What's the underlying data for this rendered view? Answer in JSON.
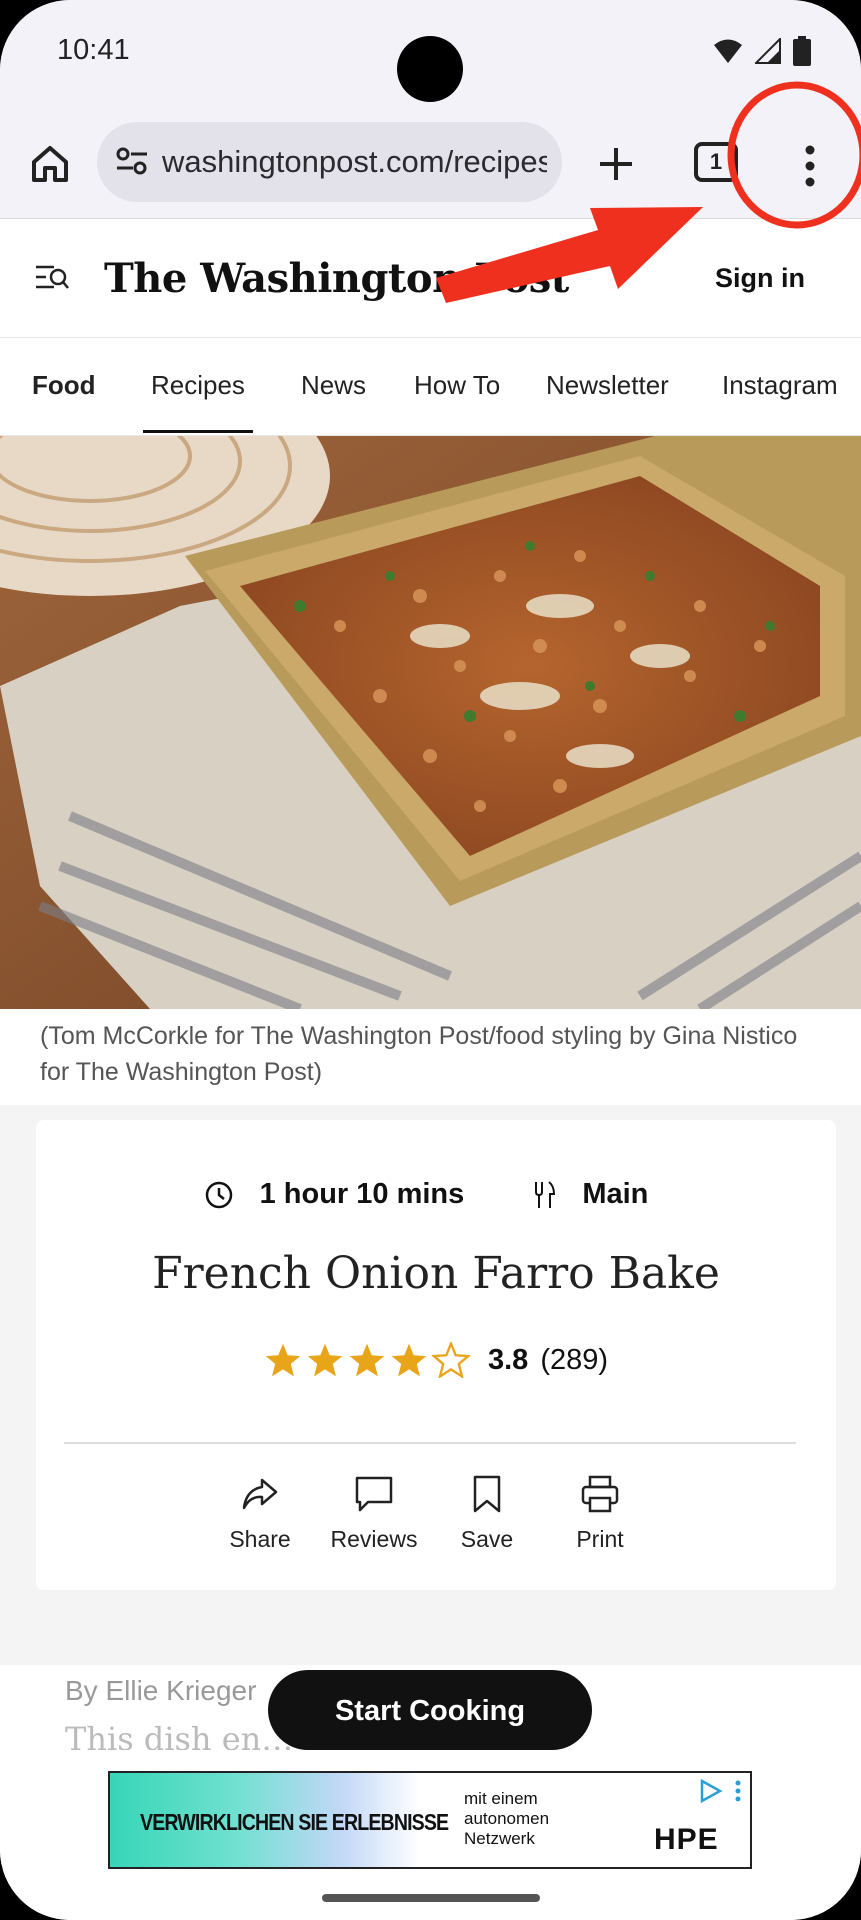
{
  "status_bar": {
    "time": "10:41"
  },
  "browser": {
    "url": "washingtonpost.com/recipes/french-onion-farro-bake/",
    "tab_count": "1"
  },
  "site": {
    "logo": "The Washington Post",
    "sign_in": "Sign in",
    "nav": [
      "Food",
      "Recipes",
      "News",
      "How To",
      "Newsletter",
      "Instagram"
    ]
  },
  "recipe": {
    "photo_caption": "(Tom McCorkle for The Washington Post/food styling by Gina Nistico for The Washington Post)",
    "time": "1 hour 10 mins",
    "course": "Main",
    "title": "French Onion Farro Bake",
    "rating": {
      "stars": 3.8,
      "value": "3.8",
      "count": "(289)"
    },
    "actions": {
      "share": "Share",
      "reviews": "Reviews",
      "save": "Save",
      "print": "Print"
    },
    "byline": "By Ellie Krieger",
    "body_preview": "This dish en… flavors of",
    "start_cooking": "Start Cooking"
  },
  "ad": {
    "headline": "VERWIRKLICHEN SIE ERLEBNISSE",
    "subtext": "mit einem autonomen Netzwerk",
    "brand": "HPE"
  },
  "colors": {
    "annotation_red": "#f0301e",
    "star_gold": "#e8a51a",
    "browser_chrome": "#f3f2f8"
  }
}
